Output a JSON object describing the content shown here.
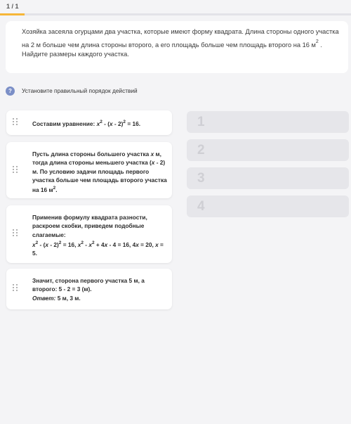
{
  "header": {
    "counter": "1 / 1",
    "progress": 0.07
  },
  "question": {
    "line1": "Хозяйка засеяла огурцами два участка, которые имеют форму квадрата. Длина стороны одного участка на 2 м больше чем длина стороны второго, а его площадь больше чем площадь второго на 16 м",
    "exp": "2",
    "line1_end": " .",
    "line2": "Найдите размеры каждого участка."
  },
  "instruction": {
    "icon": "?",
    "text": "Установите правильный порядок действий"
  },
  "steps": [
    {
      "a": "Составим уравнение:  ",
      "b": "x",
      "c": "2",
      "d": " - (",
      "e": "x",
      "f": " - 2)",
      "g": "2",
      "h": " = 16."
    },
    {
      "a": "Пусть длина стороны большего участка ",
      "b": "x",
      "c": " м, тогда длина стороны меньшего участка (",
      "d": "x",
      "e": " - 2) м. По условию задачи площадь первого участка больше чем площадь второго участка на 16 м",
      "f": "2",
      "g": "."
    },
    {
      "a": "Применив формулу квадрата разности, раскроем скобки, приведем подобные слагаемые:",
      "x1": "x",
      "p1": "2",
      "t1": " - (",
      "x2": "x",
      "t2": " - 2)",
      "p2": "2",
      "t3": " = 16,     ",
      "x3": "x",
      "p3": "2",
      "t4": " - ",
      "x4": "x",
      "p4": "2",
      "t5": " + 4",
      "x5": "x",
      "t6": " - 4 = 16,     4",
      "x6": "x",
      "t7": " = 20,    ",
      "x7": "x",
      "t8": " = 5."
    },
    {
      "a": "Значит, сторона первого участка 5 м, а второго:   5 - 2 = 3 (м).",
      "answer_label": "Ответ:",
      "answer": " 5 м,   3 м."
    }
  ],
  "slots": [
    "1",
    "2",
    "3",
    "4"
  ],
  "colors": {
    "background": "#f4f4f6",
    "progress": "#f6b638",
    "help_icon": "#7b8fc7",
    "slot": "#e6e6ea",
    "slot_number": "#cfcfd4"
  }
}
